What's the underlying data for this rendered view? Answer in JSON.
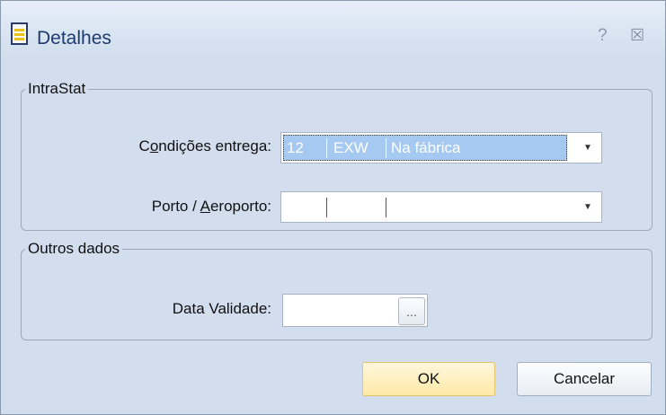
{
  "window": {
    "title": "Detalhes",
    "help_glyph": "?",
    "close_glyph": "☒",
    "icon": "document-icon"
  },
  "intrastat": {
    "legend": "IntraStat",
    "condicoes_label_pre": "C",
    "condicoes_label_ul": "o",
    "condicoes_label_post": "ndições entrega:",
    "condicoes_value": [
      "12",
      "EXW",
      "Na fábrica"
    ],
    "porto_label_pre": "Porto / ",
    "porto_label_ul": "A",
    "porto_label_post": "eroporto:",
    "porto_value": [
      "",
      "",
      ""
    ]
  },
  "outros": {
    "legend": "Outros dados",
    "data_validade_label": "Data Validade:",
    "data_validade_value": "",
    "browse_glyph": "..."
  },
  "buttons": {
    "ok": "OK",
    "cancel": "Cancelar"
  },
  "colors": {
    "selection": "#a6c9f1",
    "window_bg": "#d2dded",
    "ok_bg": "#ffe9a8"
  }
}
